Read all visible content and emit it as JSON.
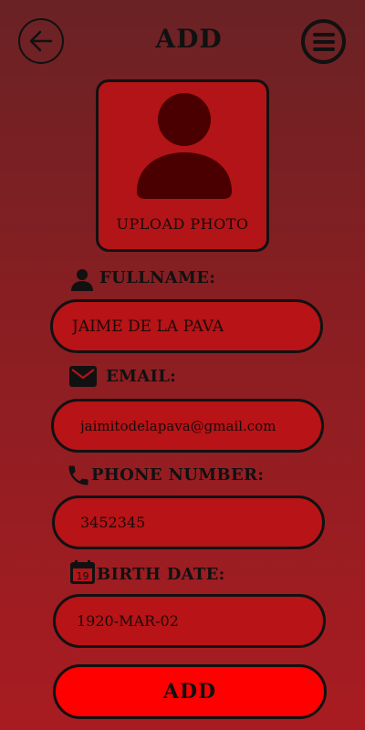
{
  "header": {
    "title": "ADD",
    "back_icon": "arrow-left-icon",
    "menu_icon": "hamburger-menu-icon"
  },
  "photo": {
    "label": "UPLOAD PHOTO",
    "icon": "user-silhouette-icon"
  },
  "form": {
    "fullname": {
      "label": "FULLNAME:",
      "value": "JAIME DE LA PAVA",
      "icon": "person-icon"
    },
    "email": {
      "label": "EMAIL:",
      "value": "jaimitodelapava@gmail.com",
      "icon": "envelope-icon"
    },
    "phone": {
      "label": "PHONE NUMBER:",
      "value": "3452345",
      "icon": "phone-icon"
    },
    "birth": {
      "label": "BIRTH DATE:",
      "value": "1920-MAR-02",
      "icon": "calendar-icon",
      "calendar_day": "19"
    }
  },
  "submit": {
    "label": "ADD"
  },
  "colors": {
    "background_top": "#6a2225",
    "background_bottom": "#a81c21",
    "field_fill": "#b81316",
    "button_fill": "#ff0000"
  }
}
